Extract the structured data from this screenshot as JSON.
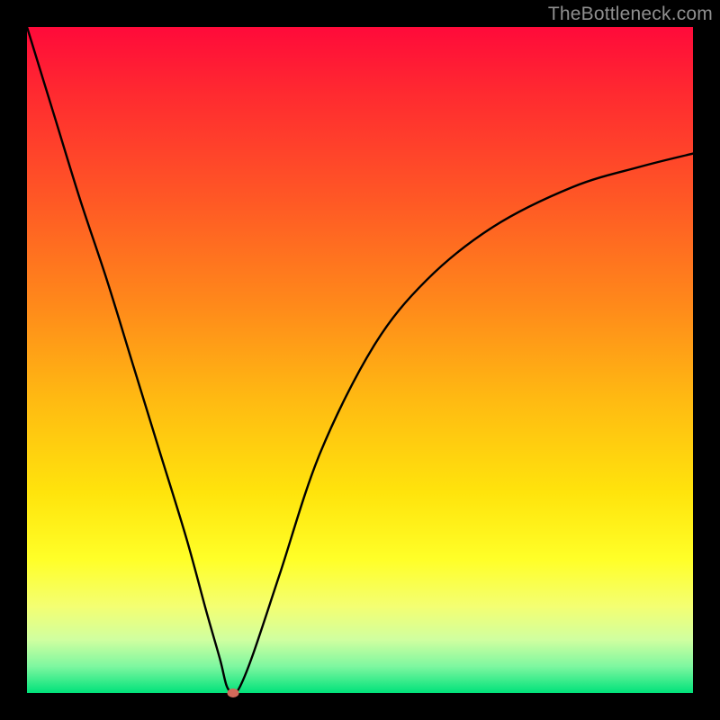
{
  "watermark": "TheBottleneck.com",
  "chart_data": {
    "type": "line",
    "title": "",
    "xlabel": "",
    "ylabel": "",
    "xlim": [
      0,
      100
    ],
    "ylim": [
      0,
      100
    ],
    "grid": false,
    "legend": false,
    "series": [
      {
        "name": "curve",
        "x": [
          0,
          4,
          8,
          12,
          16,
          20,
          24,
          27,
          29,
          30,
          31,
          32,
          34,
          38,
          44,
          52,
          60,
          70,
          82,
          92,
          100
        ],
        "y": [
          100,
          87,
          74,
          62,
          49,
          36,
          23,
          12,
          5,
          1,
          0,
          1,
          6,
          18,
          36,
          52,
          62,
          70,
          76,
          79,
          81
        ]
      }
    ],
    "minimum_marker": {
      "x": 31,
      "y": 0
    },
    "background": {
      "type": "vertical-gradient",
      "stops": [
        {
          "pos": 0.0,
          "color": "#ff0a3a"
        },
        {
          "pos": 0.42,
          "color": "#ff8a1a"
        },
        {
          "pos": 0.7,
          "color": "#ffe40c"
        },
        {
          "pos": 0.87,
          "color": "#f4ff72"
        },
        {
          "pos": 1.0,
          "color": "#00e27a"
        }
      ]
    }
  }
}
